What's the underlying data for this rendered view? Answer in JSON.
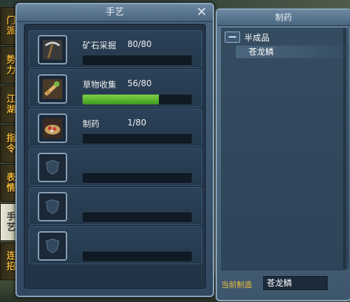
{
  "left_tabs": [
    "门派",
    "势力",
    "江湖",
    "指令",
    "表情",
    "手艺",
    "连招"
  ],
  "active_tab_index": 5,
  "skill_window": {
    "title": "手艺",
    "close_icon": "close-x-icon",
    "skills": [
      {
        "name": "矿石采掘",
        "value": "80/80",
        "progress": 0.0,
        "icon": "pickaxe-icon"
      },
      {
        "name": "草物收集",
        "value": "56/80",
        "progress": 0.7,
        "icon": "herb-bundle-icon"
      },
      {
        "name": "制药",
        "value": "1/80",
        "progress": 0.0,
        "icon": "medicine-bowl-icon"
      },
      {
        "name": "",
        "value": "",
        "progress": 0.0,
        "icon": "empty-shield-icon"
      },
      {
        "name": "",
        "value": "",
        "progress": 0.0,
        "icon": "empty-shield-icon"
      },
      {
        "name": "",
        "value": "",
        "progress": 0.0,
        "icon": "empty-shield-icon"
      }
    ]
  },
  "craft_window": {
    "title": "制药",
    "category": "半成品",
    "collapse_symbol": "—",
    "recipe": "苍龙鳞",
    "current_label": "当前制造",
    "current_value": "苍龙鳞"
  },
  "colors": {
    "accent": "#f0b73b",
    "progress": "#5db52e",
    "frame": "#8aa4bc"
  }
}
